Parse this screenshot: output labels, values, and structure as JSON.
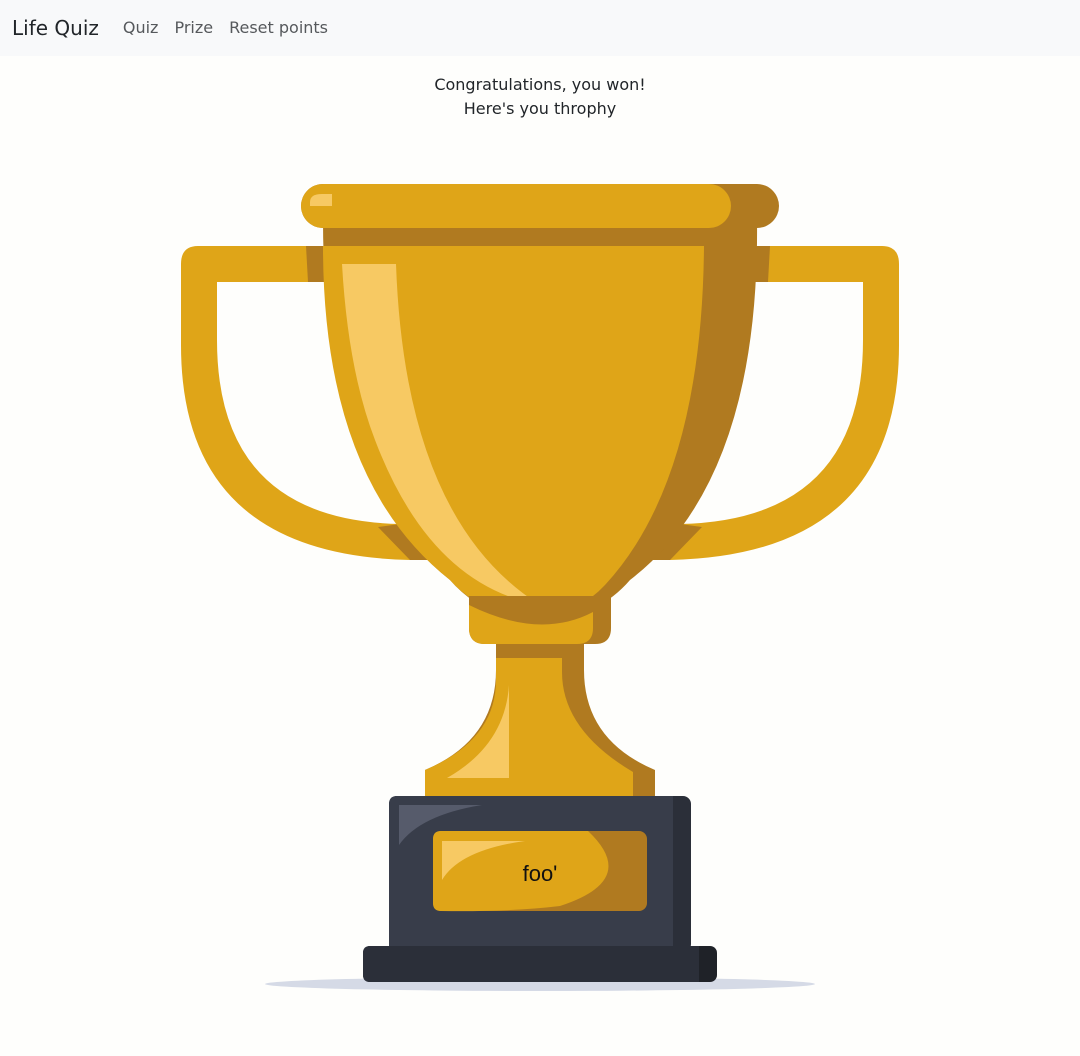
{
  "navbar": {
    "brand": "Life Quiz",
    "links": [
      {
        "label": "Quiz"
      },
      {
        "label": "Prize"
      },
      {
        "label": "Reset points"
      }
    ]
  },
  "main": {
    "message_line1": "Congratulations, you won!",
    "message_line2": "Here's you throphy",
    "trophy": {
      "plaque_text": "foo'",
      "colors": {
        "gold": "#dfa518",
        "gold_shadow": "#b07a20",
        "gold_highlight": "#f7c963",
        "base_dark": "#383d4a",
        "base_darker": "#2b2f39",
        "base_darkest": "#1f2228",
        "base_highlight": "#565b6b",
        "floor_shadow": "#d5dae6"
      }
    }
  }
}
